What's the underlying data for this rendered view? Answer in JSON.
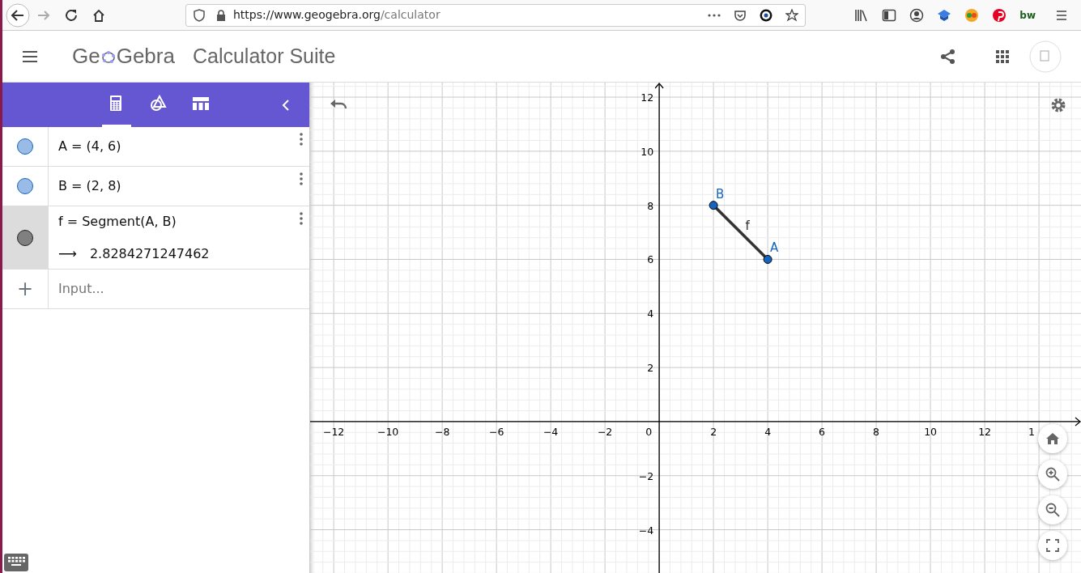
{
  "browser": {
    "url_host": "https://www.geogebra.org",
    "url_path": "/calculator",
    "extension_label": "bw"
  },
  "header": {
    "logo_start": "Ge",
    "logo_end": "Gebra",
    "title": "Calculator Suite"
  },
  "toolbar": {
    "tabs": [
      {
        "kind": "calculator",
        "selected": true
      },
      {
        "kind": "geometry",
        "selected": false
      },
      {
        "kind": "table",
        "selected": false
      }
    ]
  },
  "algebra": {
    "items": [
      {
        "kind": "point",
        "definition": "A = (4, 6)",
        "color": "#99bbe6",
        "selected": false
      },
      {
        "kind": "point",
        "definition": "B = (2, 8)",
        "color": "#99bbe6",
        "selected": false
      },
      {
        "kind": "segment",
        "definition": "f = Segment(A, B)",
        "output_arrow": "⟶",
        "output": "2.8284271247462",
        "color": "#808080",
        "selected": true
      }
    ],
    "input": {
      "add": "+",
      "placeholder": "Input..."
    }
  },
  "graphics": {
    "origin_label": "0",
    "edge_label": "1",
    "chart_data": {
      "type": "line",
      "grid": true,
      "x": [
        2,
        4
      ],
      "xlim": [
        -12.87,
        15.55
      ],
      "ylim": [
        -5.6,
        12.54
      ],
      "xticks": [
        {
          "value": -12,
          "label": "−12"
        },
        {
          "value": -10,
          "label": "−10"
        },
        {
          "value": -8,
          "label": "−8"
        },
        {
          "value": -6,
          "label": "−6"
        },
        {
          "value": -4,
          "label": "−4"
        },
        {
          "value": -2,
          "label": "−2"
        },
        {
          "value": 2,
          "label": "2"
        },
        {
          "value": 4,
          "label": "4"
        },
        {
          "value": 6,
          "label": "6"
        },
        {
          "value": 8,
          "label": "8"
        },
        {
          "value": 10,
          "label": "10"
        },
        {
          "value": 12,
          "label": "12"
        }
      ],
      "yticks": [
        {
          "value": 12,
          "label": "12"
        },
        {
          "value": 10,
          "label": "10"
        },
        {
          "value": 8,
          "label": "8"
        },
        {
          "value": 6,
          "label": "6"
        },
        {
          "value": 4,
          "label": "4"
        },
        {
          "value": 2,
          "label": "2"
        },
        {
          "value": -2,
          "label": "−2"
        },
        {
          "value": -4,
          "label": "−4"
        }
      ],
      "series": [
        {
          "name": "f",
          "color": "#333333",
          "values": [
            8,
            6
          ]
        },
        {
          "name": "A",
          "color": "#1565c0",
          "marker": "circle",
          "values": [
            null,
            6
          ]
        },
        {
          "name": "B",
          "color": "#1565c0",
          "marker": "circle",
          "values": [
            8,
            null
          ]
        }
      ]
    }
  }
}
